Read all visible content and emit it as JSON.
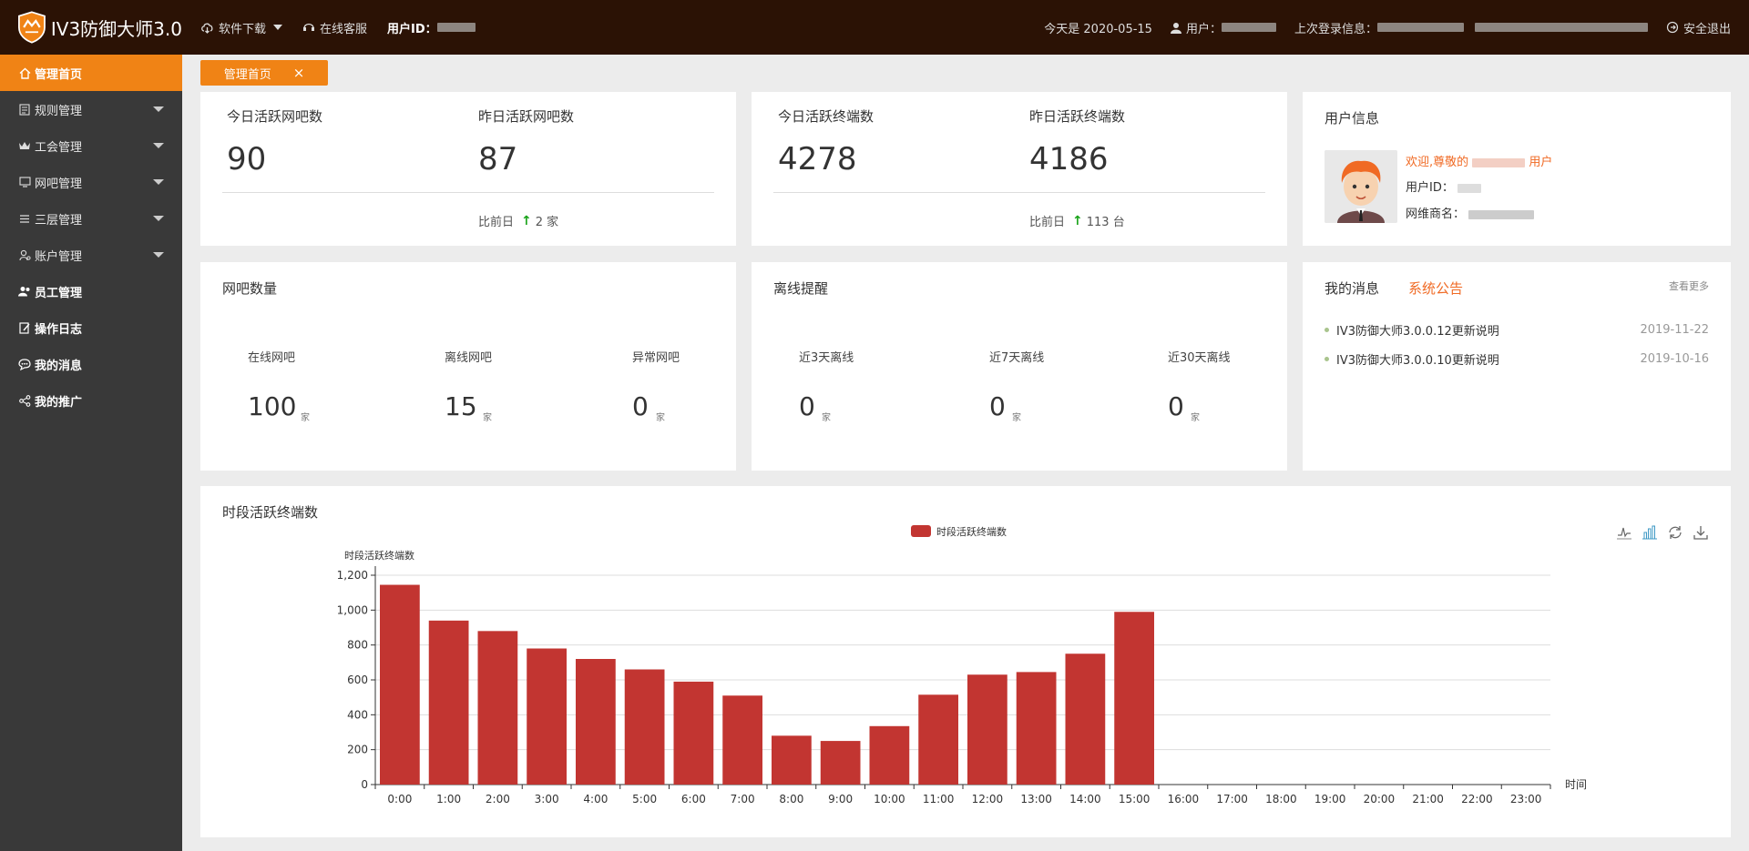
{
  "app": {
    "title": "IV3防御大师3.0"
  },
  "topnav": {
    "download": "软件下载",
    "service": "在线客服",
    "userid_label": "用户ID："
  },
  "topright": {
    "today": "今天是 2020-05-15",
    "user_label": "用户：",
    "last_login_label": "上次登录信息：",
    "logout": "安全退出"
  },
  "sidebar": {
    "items": [
      {
        "label": "管理首页",
        "icon": "home-icon"
      },
      {
        "label": "规则管理",
        "icon": "rules-icon"
      },
      {
        "label": "工会管理",
        "icon": "crown-icon"
      },
      {
        "label": "网吧管理",
        "icon": "netcafe-icon"
      },
      {
        "label": "三层管理",
        "icon": "list-icon"
      },
      {
        "label": "账户管理",
        "icon": "account-icon"
      },
      {
        "label": "员工管理",
        "icon": "staff-icon"
      },
      {
        "label": "操作日志",
        "icon": "log-icon"
      },
      {
        "label": "我的消息",
        "icon": "message-icon"
      },
      {
        "label": "我的推广",
        "icon": "share-icon"
      }
    ]
  },
  "tabs": {
    "home": "管理首页",
    "close": "×"
  },
  "netcafe_stats": {
    "today_label": "今日活跃网吧数",
    "today_value": "90",
    "yesterday_label": "昨日活跃网吧数",
    "yesterday_value": "87",
    "compare_label": "比前日",
    "compare_arrow": "↑",
    "compare_value": "2 家"
  },
  "terminal_stats": {
    "today_label": "今日活跃终端数",
    "today_value": "4278",
    "yesterday_label": "昨日活跃终端数",
    "yesterday_value": "4186",
    "compare_label": "比前日",
    "compare_arrow": "↑",
    "compare_value": "113 台"
  },
  "user_info": {
    "title": "用户信息",
    "welcome_prefix": "欢迎,尊敬的",
    "welcome_suffix": "用户",
    "id_label": "用户ID：",
    "vendor_label": "网维商名："
  },
  "netcafe_count": {
    "title": "网吧数量",
    "items": [
      {
        "label": "在线网吧",
        "value": "100",
        "unit": "家"
      },
      {
        "label": "离线网吧",
        "value": "15",
        "unit": "家"
      },
      {
        "label": "异常网吧",
        "value": "0",
        "unit": "家"
      }
    ]
  },
  "offline_alert": {
    "title": "离线提醒",
    "items": [
      {
        "label": "近3天离线",
        "value": "0",
        "unit": "家"
      },
      {
        "label": "近7天离线",
        "value": "0",
        "unit": "家"
      },
      {
        "label": "近30天离线",
        "value": "0",
        "unit": "家"
      }
    ]
  },
  "messages": {
    "tab_mine": "我的消息",
    "tab_system": "系统公告",
    "more": "查看更多",
    "items": [
      {
        "title": "IV3防御大师3.0.0.12更新说明",
        "date": "2019-11-22"
      },
      {
        "title": "IV3防御大师3.0.0.10更新说明",
        "date": "2019-10-16"
      }
    ]
  },
  "chart_panel": {
    "title": "时段活跃终端数"
  },
  "colors": {
    "accent": "#f08315",
    "bar": "#c23531",
    "topbar": "#2b1205",
    "sidebar": "#393939"
  },
  "chart_data": {
    "type": "bar",
    "legend": "时段活跃终端数",
    "ylabel": "时段活跃终端数",
    "xlabel": "时间",
    "ylim": [
      0,
      1200
    ],
    "yticks": [
      "0",
      "200",
      "400",
      "600",
      "800",
      "1,000",
      "1,200"
    ],
    "categories": [
      "0:00",
      "1:00",
      "2:00",
      "3:00",
      "4:00",
      "5:00",
      "6:00",
      "7:00",
      "8:00",
      "9:00",
      "10:00",
      "11:00",
      "12:00",
      "13:00",
      "14:00",
      "15:00",
      "16:00",
      "17:00",
      "18:00",
      "19:00",
      "20:00",
      "21:00",
      "22:00",
      "23:00"
    ],
    "values": [
      1145,
      940,
      880,
      780,
      720,
      660,
      590,
      510,
      280,
      250,
      335,
      515,
      630,
      645,
      750,
      990,
      0,
      0,
      0,
      0,
      0,
      0,
      0,
      0
    ],
    "grid": true,
    "legend_position": "top-center"
  }
}
